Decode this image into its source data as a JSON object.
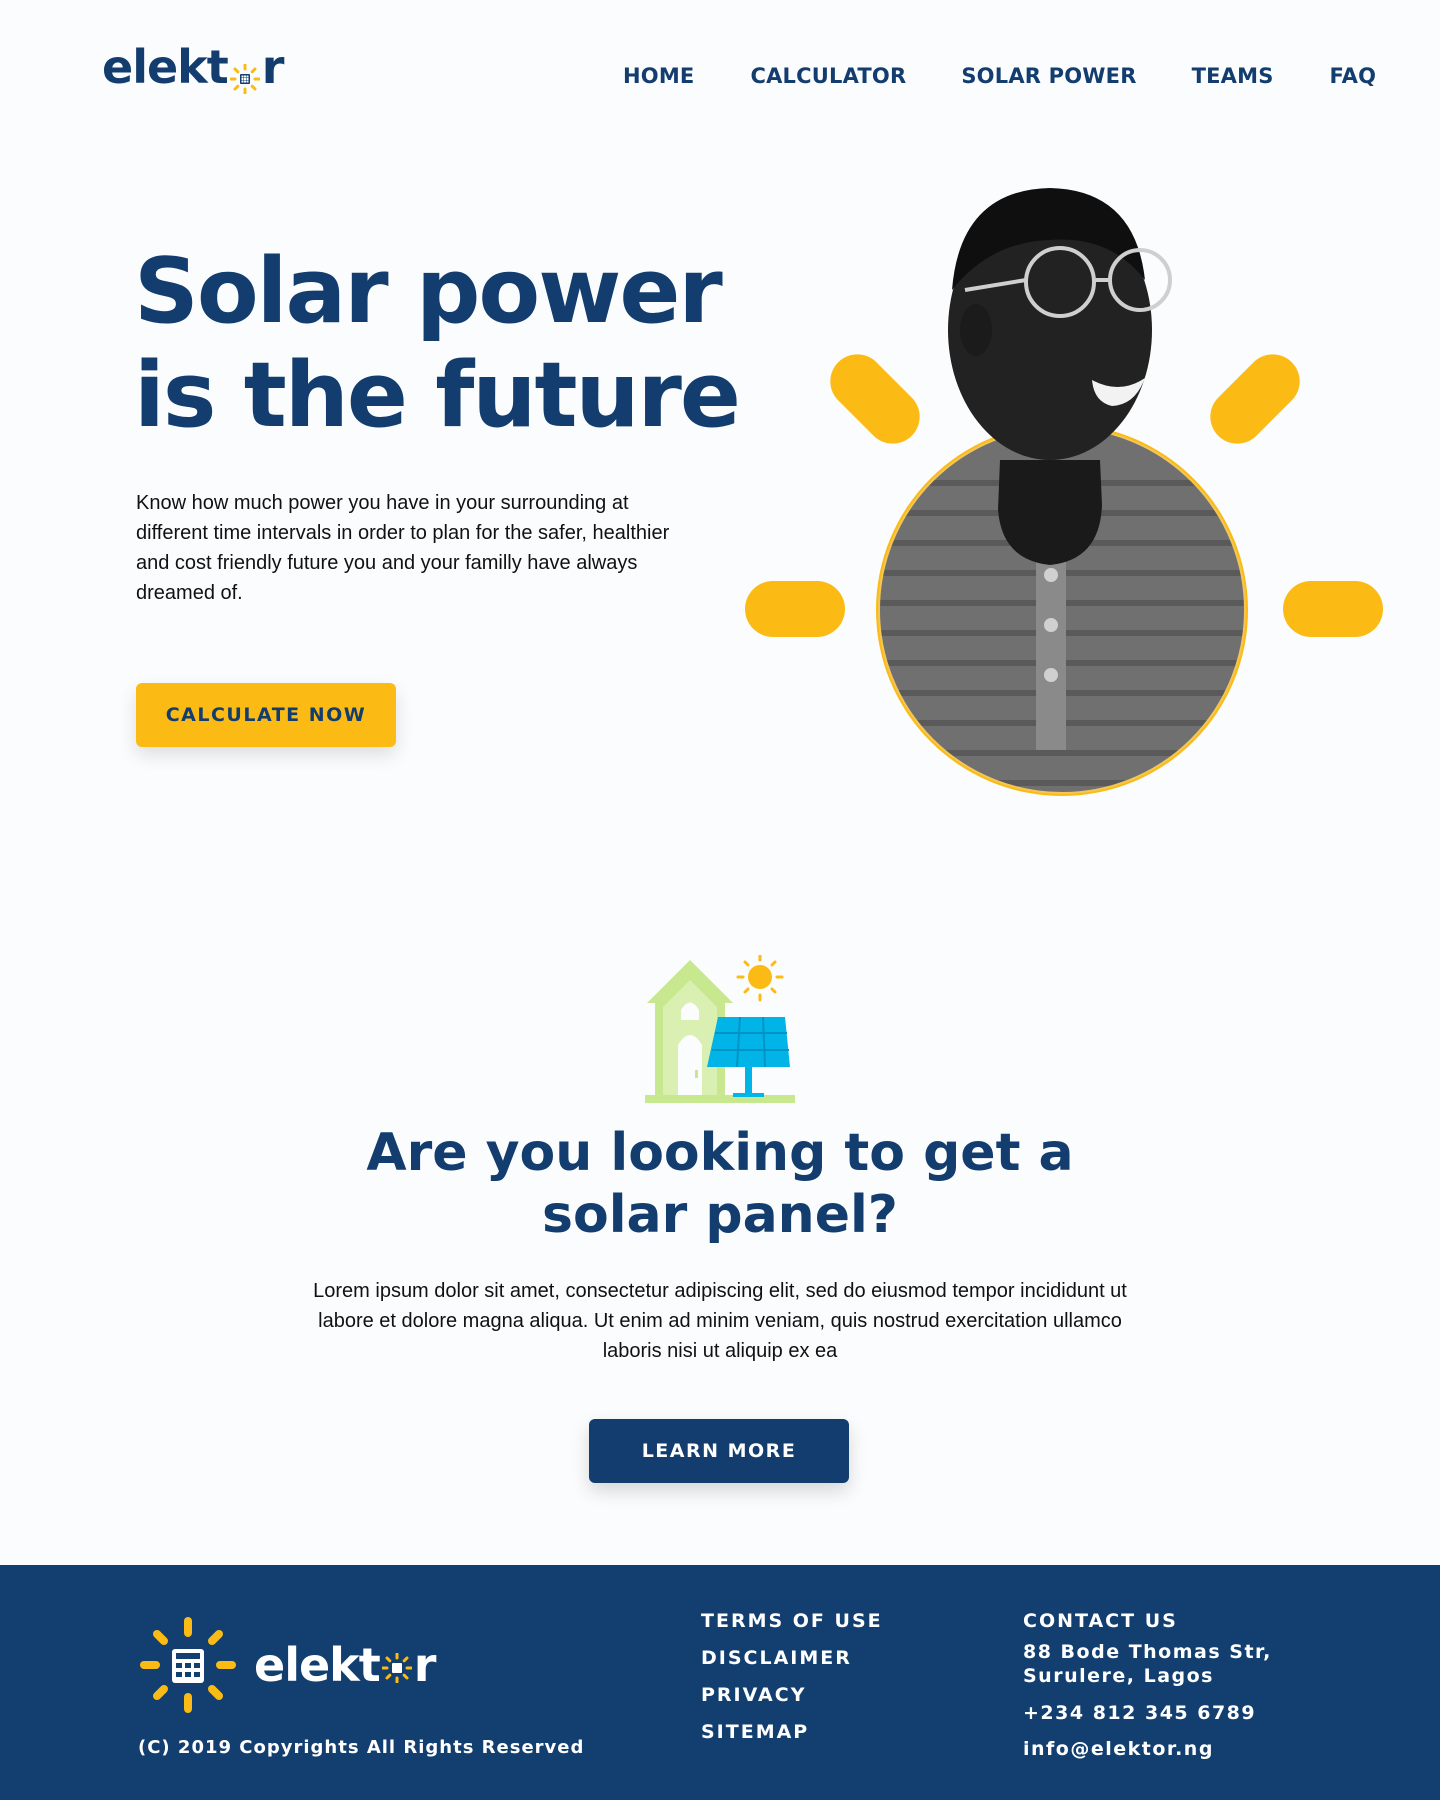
{
  "header": {
    "logo_prefix": "elekt",
    "logo_suffix": "r",
    "nav": [
      "HOME",
      "CALCULATOR",
      "SOLAR POWER",
      "TEAMS",
      "FAQ"
    ]
  },
  "hero": {
    "title_line1": "Solar power",
    "title_line2": "is the future",
    "text": "Know how much power you have in your surrounding at different time intervals in order to plan for the safer, healthier and cost friendly future you and your familly have always dreamed of.",
    "button_label": "CALCULATE NOW"
  },
  "section": {
    "title_line1": "Are you looking to get a",
    "title_line2": "solar panel?",
    "text": "Lorem ipsum dolor sit amet, consectetur adipiscing elit, sed do eiusmod tempor incididunt ut labore et dolore magna aliqua. Ut enim ad minim veniam, quis nostrud exercitation ullamco laboris nisi ut aliquip ex ea",
    "button_label": "LEARN MORE"
  },
  "footer": {
    "logo_prefix": "elekt",
    "logo_suffix": "r",
    "copyright": "(C) 2019 Copyrights All Rights Reserved",
    "links": [
      "TERMS OF USE",
      "DISCLAIMER",
      "PRIVACY",
      "SITEMAP"
    ],
    "contact_heading": "CONTACT US",
    "address": "88 Bode Thomas Str, Surulere, Lagos",
    "phone": "+234 812 345 6789",
    "email": "info@elektor.ng"
  },
  "colors": {
    "primary": "#123d6e",
    "accent": "#fbbb14",
    "background": "#fbfcfd",
    "house_green": "#c8e88f",
    "panel_blue": "#00b4e8"
  },
  "icons": [
    "sun-calculator-logo-icon",
    "house-solar-panel-icon"
  ]
}
